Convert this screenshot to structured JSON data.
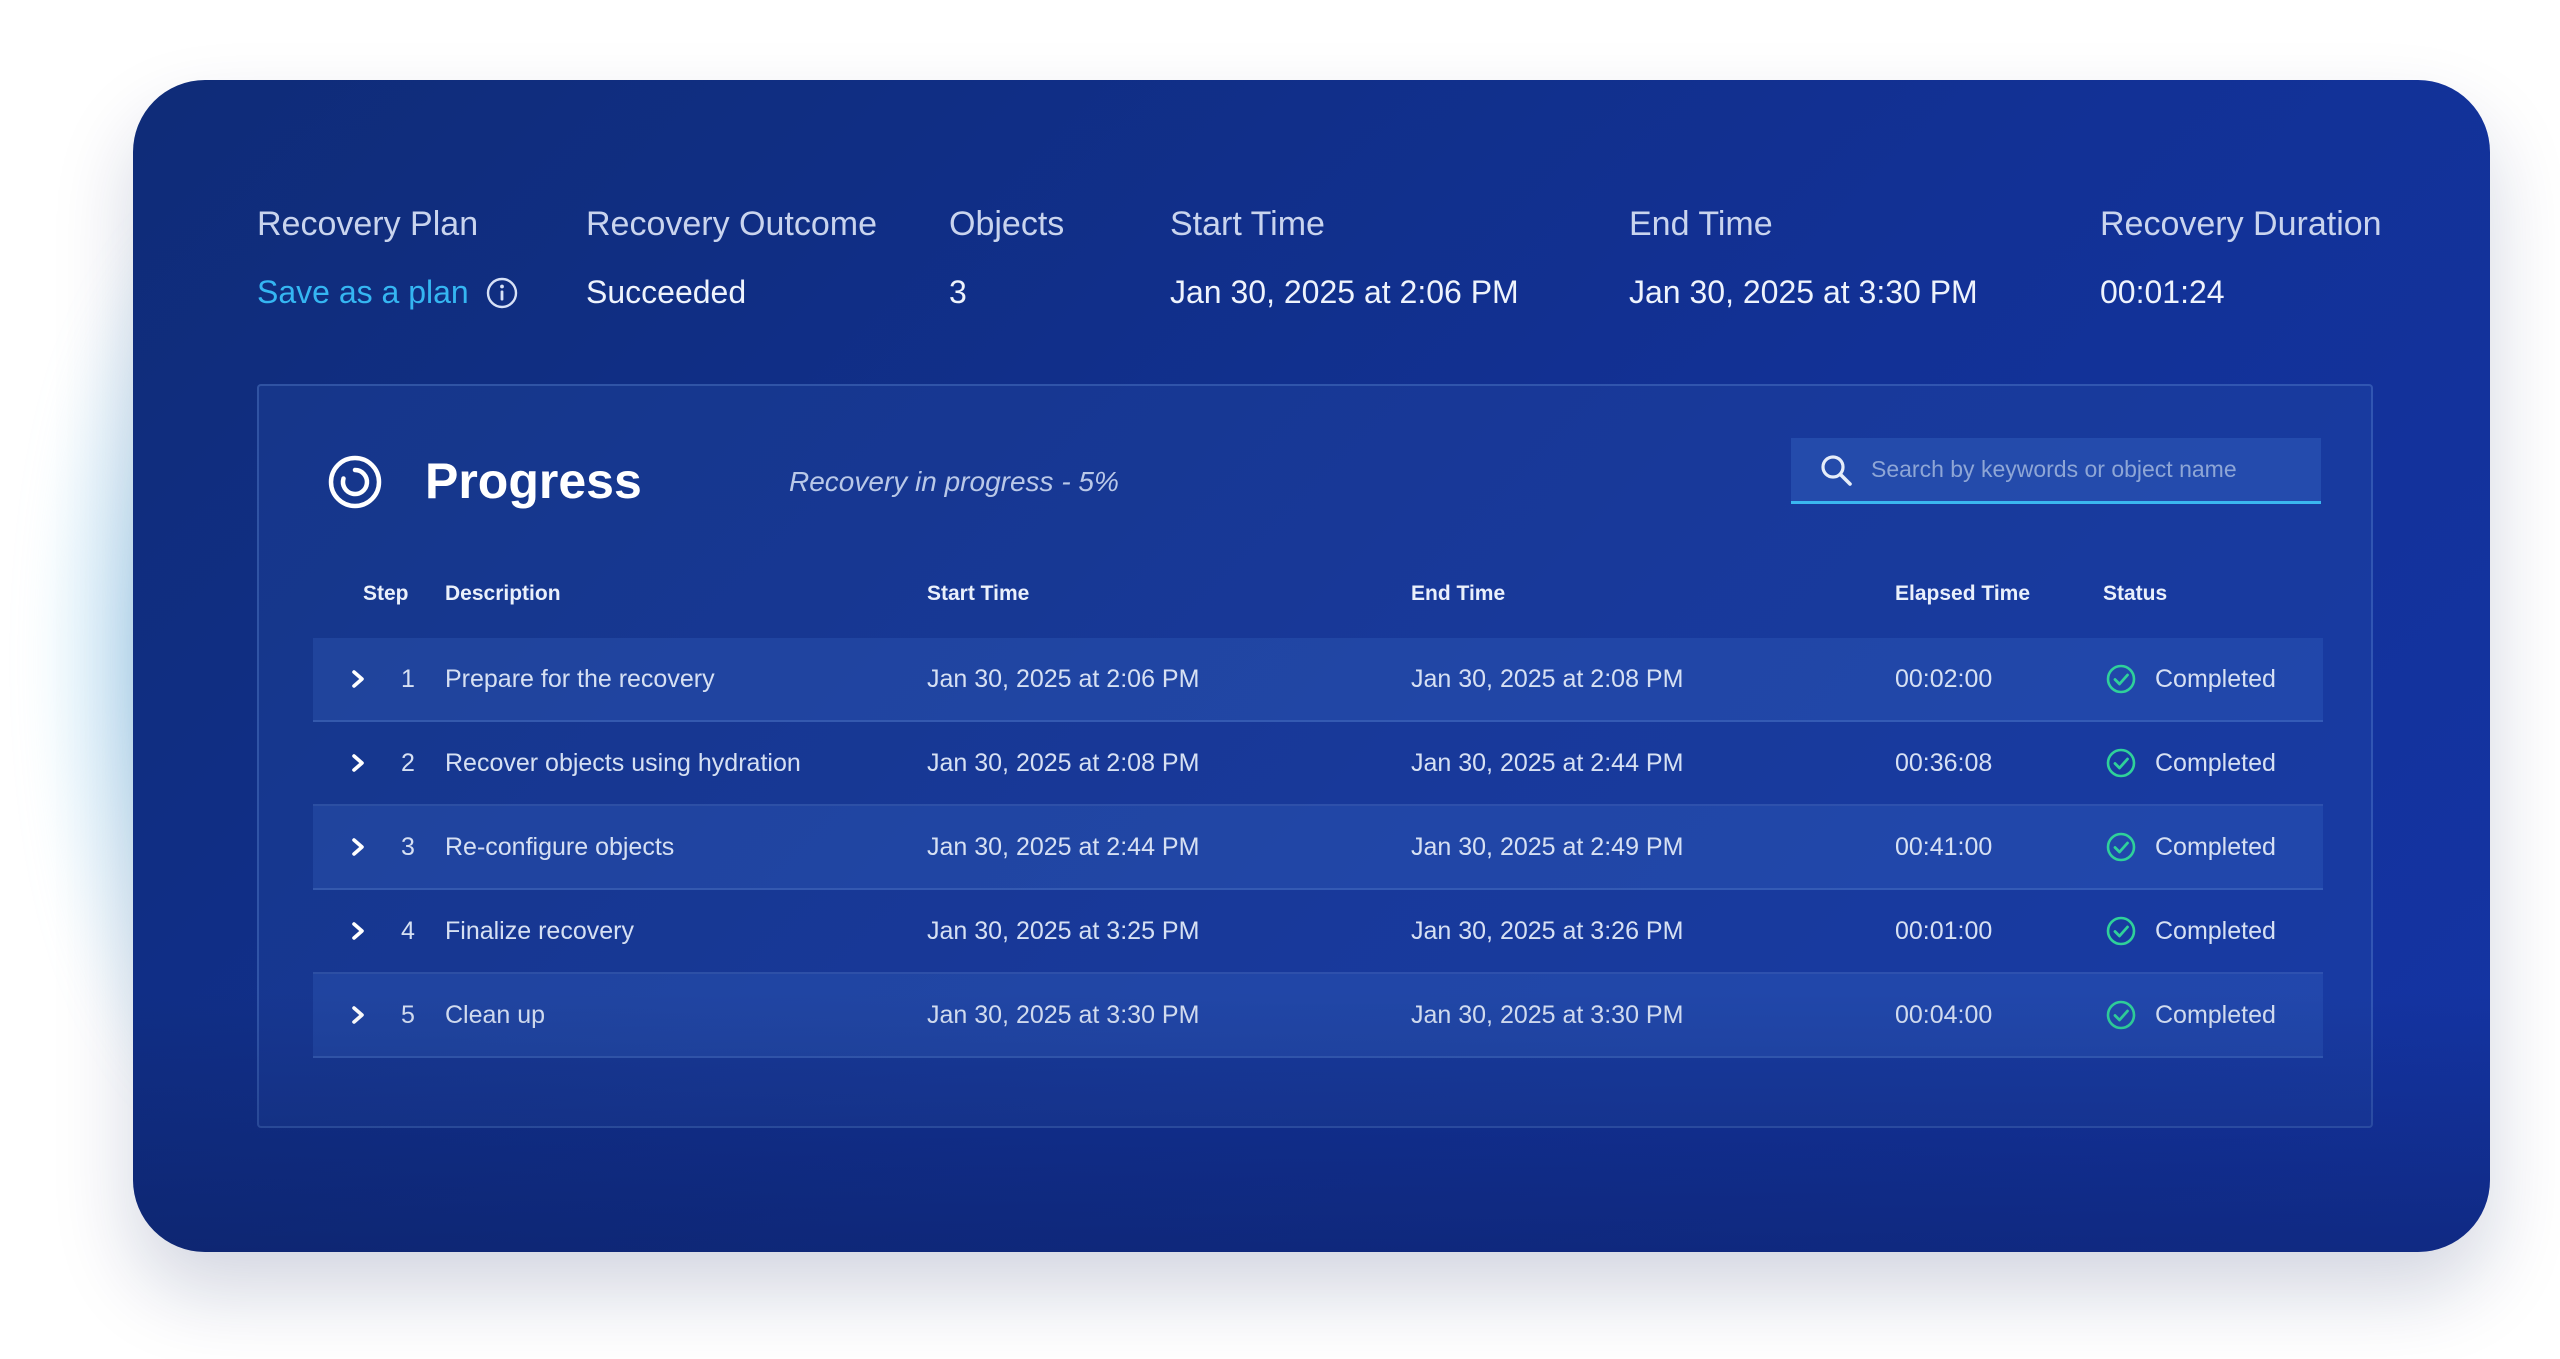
{
  "summary": {
    "plan_label": "Recovery Plan",
    "plan_value": "Save as a plan",
    "outcome_label": "Recovery Outcome",
    "outcome_value": "Succeeded",
    "objects_label": "Objects",
    "objects_value": "3",
    "start_label": "Start Time",
    "start_value": "Jan 30, 2025 at 2:06 PM",
    "end_label": "End Time",
    "end_value": "Jan 30, 2025 at 3:30 PM",
    "duration_label": "Recovery Duration",
    "duration_value": "00:01:24"
  },
  "progress": {
    "title": "Progress",
    "status_text": "Recovery in progress - 5%",
    "search_placeholder": "Search by keywords or object name"
  },
  "table": {
    "headers": {
      "step": "Step",
      "description": "Description",
      "start": "Start Time",
      "end": "End Time",
      "elapsed": "Elapsed Time",
      "status": "Status"
    },
    "rows": [
      {
        "step": "1",
        "description": "Prepare for the recovery",
        "start": "Jan 30, 2025 at 2:06 PM",
        "end": "Jan 30, 2025 at 2:08 PM",
        "elapsed": "00:02:00",
        "status": "Completed"
      },
      {
        "step": "2",
        "description": "Recover objects using hydration",
        "start": "Jan 30, 2025 at 2:08 PM",
        "end": "Jan 30, 2025 at 2:44 PM",
        "elapsed": "00:36:08",
        "status": "Completed"
      },
      {
        "step": "3",
        "description": "Re-configure objects",
        "start": "Jan 30, 2025 at 2:44 PM",
        "end": "Jan 30, 2025 at 2:49 PM",
        "elapsed": "00:41:00",
        "status": "Completed"
      },
      {
        "step": "4",
        "description": "Finalize recovery",
        "start": "Jan 30, 2025 at 3:25 PM",
        "end": "Jan 30, 2025 at 3:26 PM",
        "elapsed": "00:01:00",
        "status": "Completed"
      },
      {
        "step": "5",
        "description": "Clean up",
        "start": "Jan 30, 2025 at 3:30 PM",
        "end": "Jan 30, 2025 at 3:30 PM",
        "elapsed": "00:04:00",
        "status": "Completed"
      }
    ]
  },
  "icons": {
    "info": "info-icon",
    "progress": "progress-spinner-icon",
    "search": "search-icon",
    "expand": "chevron-right-icon",
    "status": "check-circle-icon"
  },
  "colors": {
    "card_bg": "#123195",
    "link": "#35b6f2",
    "success": "#2fd19a"
  }
}
